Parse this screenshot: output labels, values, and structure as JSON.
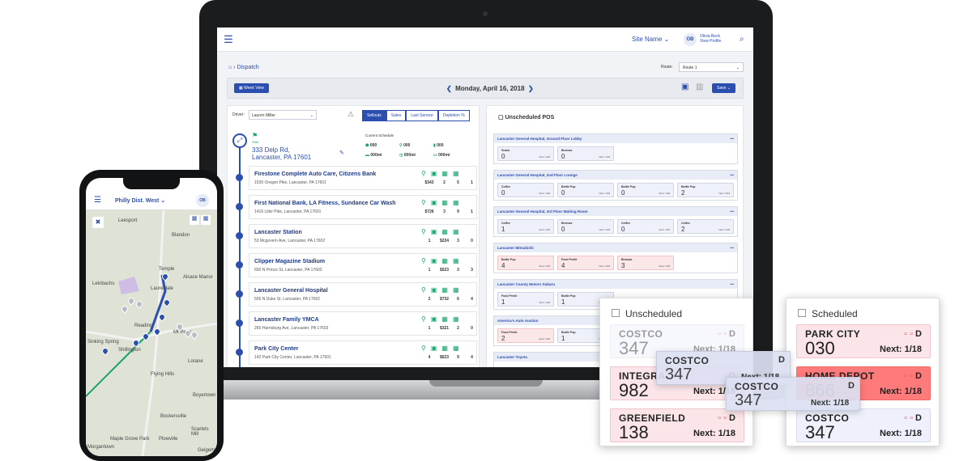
{
  "app": {
    "site_name": "Site Name",
    "user_initials": "OB",
    "user_name": "Olivia Beck",
    "user_link": "View Profile",
    "breadcrumb": "Dispatch",
    "route_label": "Route:",
    "route_value": "Route 1",
    "week_view": "Week View",
    "date": "Monday, April 16, 2018",
    "save": "Save"
  },
  "left": {
    "driver_label": "Driver:",
    "driver_value": "Lauren Miller",
    "tabs": [
      "Sellouts",
      "Sales",
      "Last Service",
      "Depletion %"
    ],
    "start_label": "Start",
    "start_address_1": "333 Delp Rd,",
    "start_address_2": "Lancaster, PA 17601",
    "schedule_label": "Current Schedule",
    "schedule_vals": [
      "000",
      "000",
      "000",
      "000mi",
      "000mi",
      "000mi"
    ],
    "stops": [
      {
        "name": "Firestone Complete Auto Care, Citizens Bank",
        "addr": "1530 Oregon Pike, Lancaster, PA 17601",
        "v": [
          "$343",
          "2",
          "5",
          "1"
        ]
      },
      {
        "name": "First National Bank, LA Fitness, Sundance Car Wash",
        "addr": "1416 Lititz Pike, Lancaster, PA 17601",
        "v": [
          "$726",
          "3",
          "9",
          "1"
        ]
      },
      {
        "name": "Lancaster Station",
        "addr": "53 Mcgovern Ave, Lancaster, PA 17602",
        "v": [
          "1",
          "$224",
          "3",
          "0"
        ]
      },
      {
        "name": "Clipper Magazine Stadium",
        "addr": "650 N Prince St, Lancaster, PA 17603",
        "v": [
          "1",
          "$523",
          "3",
          "3"
        ]
      },
      {
        "name": "Lancaster General Hospital",
        "addr": "555 N Duke St, Lancaster, PA 17602",
        "v": [
          "2",
          "$732",
          "6",
          "4"
        ]
      },
      {
        "name": "Lancaster Family YMCA",
        "addr": "265 Harrisburg Ave, Lancaster, PA 17603",
        "v": [
          "1",
          "$321",
          "2",
          "0"
        ]
      },
      {
        "name": "Park City Center",
        "addr": "142 Park City Center, Lancaster, PA 17601",
        "v": [
          "4",
          "$623",
          "9",
          "4"
        ]
      }
    ]
  },
  "right": {
    "title": "Unscheduled POS",
    "locations": [
      {
        "name": "Lancaster General Hospital, Ground Floor Lobby",
        "chips": [
          {
            "n": "Snack",
            "v": "0",
            "x": "Next: 1/18",
            "c": "blue"
          },
          {
            "n": "Bevmax",
            "v": "0",
            "x": "Next: 1/18",
            "c": "blue"
          }
        ]
      },
      {
        "name": "Lancaster General Hospital, 2nd Floor Lounge",
        "chips": [
          {
            "n": "Coffee",
            "v": "0",
            "x": "Next: 1/18",
            "c": "blue"
          },
          {
            "n": "Bottle Pop",
            "v": "0",
            "x": "Next: 1/18",
            "c": "blue"
          },
          {
            "n": "Bottle Pop",
            "v": "0",
            "x": "Next: 1/18",
            "c": "blue"
          },
          {
            "n": "Bottle Pop",
            "v": "2",
            "x": "Next: 4/19",
            "c": "blue"
          }
        ]
      },
      {
        "name": "Lancaster General Hospital, 3rd Floor Waiting Room",
        "chips": [
          {
            "n": "Coffee",
            "v": "1",
            "x": "Next: 1/18",
            "c": "blue"
          },
          {
            "n": "Bevmax",
            "v": "0",
            "x": "Next: 1/18",
            "c": "blue"
          },
          {
            "n": "Coffee",
            "v": "0",
            "x": "Next: 1/18",
            "c": "blue"
          },
          {
            "n": "Coffee",
            "v": "2",
            "x": "Next: 1/18",
            "c": "blue"
          }
        ]
      },
      {
        "name": "Lancaster Mitsubishi",
        "chips": [
          {
            "n": "Bottle Pop",
            "v": "4",
            "x": "Next: 1/18",
            "c": "red"
          },
          {
            "n": "Food Prekit",
            "v": "4",
            "x": "Next: 4/19",
            "c": "red"
          },
          {
            "n": "Bevmax",
            "v": "3",
            "x": "Next: 1/18",
            "c": "red"
          }
        ]
      },
      {
        "name": "Lancaster County Motors Subaru",
        "chips": [
          {
            "n": "Food Prekit",
            "v": "1",
            "x": "Next: 1/18",
            "c": "blue"
          },
          {
            "n": "Bottle Pop",
            "v": "1",
            "x": "Next: 1/18",
            "c": "blue"
          }
        ]
      },
      {
        "name": "America's Auto Auction",
        "chips": [
          {
            "n": "Food Prekit",
            "v": "2",
            "x": "Next: 1/18",
            "c": "red"
          },
          {
            "n": "Bottle Pop",
            "v": "1",
            "x": "Next: 1/18",
            "c": "blue"
          }
        ]
      },
      {
        "name": "Lancaster Toyota",
        "chips": []
      }
    ]
  },
  "phone": {
    "title": "Philly Dist. West",
    "initials": "OB",
    "towns": [
      "Leesport",
      "Blandon",
      "Temple",
      "Alsace Manor",
      "Leinbachs",
      "Laureldale",
      "Reading",
      "Mt Penn",
      "Sinking Spring",
      "Shillington",
      "Lorane",
      "Flying Hills",
      "Boyertown",
      "Bockersville",
      "Scarlets Mill",
      "Maple Grove Park",
      "Plowville",
      "Geigertown",
      "Morgantown"
    ]
  },
  "unscheduled_card": {
    "title": "Unscheduled",
    "items": [
      {
        "name": "COSTCO",
        "num": "347",
        "d": "D",
        "next": "Next: 1/18",
        "style": "blue ghost"
      },
      {
        "name": "INTEGRA",
        "num": "982",
        "d": "D",
        "next": "Next: 1/18",
        "style": "red"
      },
      {
        "name": "GREENFIELD",
        "num": "138",
        "d": "D",
        "next": "Next: 1/18",
        "style": "red"
      }
    ]
  },
  "scheduled_card": {
    "title": "Scheduled",
    "items": [
      {
        "name": "PARK CITY",
        "num": "030",
        "d": "D",
        "next": "Next: 1/18",
        "style": "red"
      },
      {
        "name": "HOME DEPOT",
        "num": "866",
        "d": "D",
        "next": "Next: 1/18",
        "style": "hot"
      },
      {
        "name": "COSTCO",
        "num": "347",
        "d": "D",
        "next": "Next: 1/18",
        "style": "blue"
      }
    ]
  },
  "dragging": [
    {
      "name": "COSTCO",
      "num": "347",
      "d": "D",
      "next": "Next: 1/18"
    },
    {
      "name": "COSTCO",
      "num": "347",
      "d": "D",
      "next": "Next: 1/18"
    }
  ]
}
